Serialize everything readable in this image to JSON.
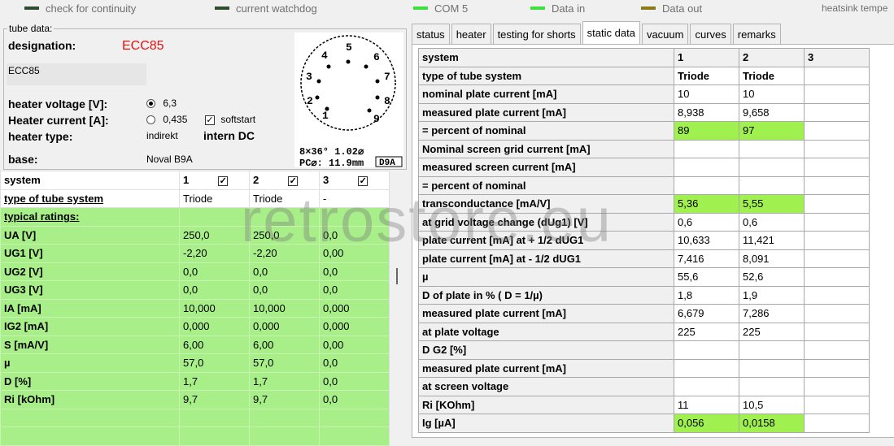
{
  "indicators": [
    {
      "label": "check for continuity",
      "color": "#2e4d2e"
    },
    {
      "label": "current watchdog",
      "color": "#2e4d2e"
    },
    {
      "label": "COM 5",
      "color": "#3de03d"
    },
    {
      "label": "Data in",
      "color": "#3de03d"
    },
    {
      "label": "Data out",
      "color": "#8a7a18"
    },
    {
      "label": "heatsink tempe"
    }
  ],
  "tube_data": {
    "legend": "tube data:",
    "designation_label": "designation:",
    "designation_value": "ECC85",
    "name_box": "ECC85",
    "heater_voltage_label": "heater voltage [V]:",
    "heater_voltage_value": "6,3",
    "heater_current_label": "Heater current [A]:",
    "heater_current_value": "0,435",
    "softstart_label": "softstart",
    "heater_type_label": "heater type:",
    "heater_type_value": "indirekt",
    "heater_supply": "intern DC",
    "base_label": "base:",
    "base_value": "Noval B9A",
    "diagram_text1": "8×36° 1.02⌀",
    "diagram_text2": "PC⌀: 11.9mm",
    "diagram_code": "D9A",
    "pins": [
      "1",
      "2",
      "3",
      "4",
      "5",
      "6",
      "7",
      "8",
      "9"
    ]
  },
  "left_table": {
    "header": [
      "system",
      "1",
      "2",
      "3"
    ],
    "type_row": [
      "type of tube system",
      "Triode",
      "Triode",
      "-"
    ],
    "typical_label": "typical ratings:",
    "rows": [
      [
        "UA [V]",
        "250,0",
        "250,0",
        "0,0"
      ],
      [
        "UG1 [V]",
        "-2,20",
        "-2,20",
        "0,00"
      ],
      [
        "UG2 [V]",
        "0,0",
        "0,0",
        "0,0"
      ],
      [
        "UG3 [V]",
        "0,0",
        "0,0",
        "0,0"
      ],
      [
        "IA [mA]",
        "10,000",
        "10,000",
        "0,000"
      ],
      [
        "IG2 [mA]",
        "0,000",
        "0,000",
        "0,000"
      ],
      [
        "S [mA/V]",
        "6,00",
        "6,00",
        "0,00"
      ],
      [
        "µ",
        "57,0",
        "57,0",
        "0,0"
      ],
      [
        "D [%]",
        "1,7",
        "1,7",
        "0,0"
      ],
      [
        "Ri [kOhm]",
        "9,7",
        "9,7",
        "0,0"
      ],
      [
        "",
        "",
        "",
        ""
      ],
      [
        "",
        "",
        "",
        ""
      ]
    ]
  },
  "tabs": [
    "status",
    "heater",
    "testing for shorts",
    "static data",
    "vacuum",
    "curves",
    "remarks"
  ],
  "active_tab": "static data",
  "static_table": {
    "header": [
      "system",
      "1",
      "2",
      "3"
    ],
    "rows": [
      {
        "label": "type of tube system",
        "v": [
          "Triode",
          "Triode",
          ""
        ],
        "bold": true,
        "green": false
      },
      {
        "label": "nominal plate current [mA]",
        "v": [
          "10",
          "10",
          ""
        ],
        "green": false
      },
      {
        "label": "measured plate current [mA]",
        "v": [
          "8,938",
          "9,658",
          ""
        ],
        "green": false
      },
      {
        "label": "= percent of nominal",
        "v": [
          "89",
          "97",
          ""
        ],
        "green": true
      },
      {
        "label": "Nominal screen grid current [mA]",
        "v": [
          "",
          "",
          ""
        ],
        "green": false
      },
      {
        "label": "measured screen current [mA]",
        "v": [
          "",
          "",
          ""
        ],
        "green": false
      },
      {
        "label": "= percent of nominal",
        "v": [
          "",
          "",
          ""
        ],
        "green": false
      },
      {
        "label": "transconductance [mA/V]",
        "v": [
          "5,36",
          "5,55",
          ""
        ],
        "green": true
      },
      {
        "label": "at grid voltage change (dUg1) [V]",
        "v": [
          "0,6",
          "0,6",
          ""
        ],
        "green": false
      },
      {
        "label": "plate current [mA] at + 1/2 dUG1",
        "v": [
          "10,633",
          "11,421",
          ""
        ],
        "green": false
      },
      {
        "label": "plate current [mA] at - 1/2 dUG1",
        "v": [
          "7,416",
          "8,091",
          ""
        ],
        "green": false
      },
      {
        "label": "µ",
        "v": [
          "55,6",
          "52,6",
          ""
        ],
        "green": false
      },
      {
        "label": "D of plate in % ( D = 1/µ)",
        "v": [
          "1,8",
          "1,9",
          ""
        ],
        "green": false
      },
      {
        "label": "measured plate current [mA]",
        "v": [
          "6,679",
          "7,286",
          ""
        ],
        "green": false
      },
      {
        "label": "at plate voltage",
        "v": [
          "225",
          "225",
          ""
        ],
        "green": false
      },
      {
        "label": "D G2 [%]",
        "v": [
          "",
          "",
          ""
        ],
        "green": false
      },
      {
        "label": "measured plate current [mA]",
        "v": [
          "",
          "",
          ""
        ],
        "green": false
      },
      {
        "label": "at screen voltage",
        "v": [
          "",
          "",
          ""
        ],
        "green": false
      },
      {
        "label": "Ri [KOhm]",
        "v": [
          "11",
          "10,5",
          ""
        ],
        "green": false
      },
      {
        "label": "Ig [µA]",
        "v": [
          "0,056",
          "0,0158",
          ""
        ],
        "green": true
      }
    ]
  },
  "watermark": "retrostore.eu"
}
